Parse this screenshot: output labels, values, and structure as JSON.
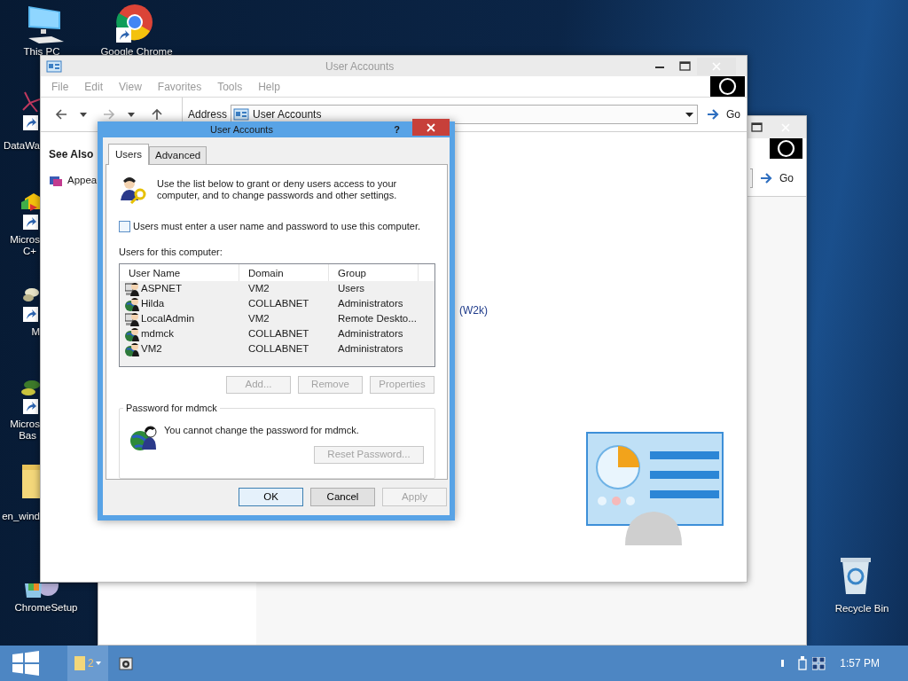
{
  "desktop_icons": [
    {
      "kind": "pc",
      "lines": [
        "This PC"
      ]
    },
    {
      "kind": "chrome",
      "lines": [
        "Google Chrome"
      ]
    },
    {
      "kind": "molecule",
      "lines": [
        "DataWa"
      ]
    },
    {
      "kind": "app",
      "lines": [
        "Micros",
        "C+"
      ]
    },
    {
      "kind": "tool",
      "lines": [
        "M"
      ]
    },
    {
      "kind": "leaf",
      "lines": [
        "Micros",
        "Bas"
      ]
    },
    {
      "kind": "folder",
      "lines": [
        "en_wind"
      ]
    },
    {
      "kind": "installer",
      "lines": [
        "ChromeSetup"
      ]
    },
    {
      "kind": "recycle",
      "lines": [
        "Recycle Bin"
      ]
    }
  ],
  "back_window": {
    "go_label": "Go"
  },
  "explorer": {
    "title": "User Accounts",
    "menu": [
      "File",
      "Edit",
      "View",
      "Favorites",
      "Tools",
      "Help"
    ],
    "nav_buttons": [
      {
        "kind": "back",
        "disabled": false
      },
      {
        "kind": "forward",
        "disabled": true
      },
      {
        "kind": "up",
        "disabled": false
      }
    ],
    "address_label": "Address",
    "address": "User Accounts",
    "go_label": "Go",
    "see_also": "See Also",
    "tasks": [
      "Appea"
    ],
    "content_text": "(W2k)"
  },
  "dialog": {
    "title": "User Accounts",
    "help": "?",
    "tabs": [
      {
        "label": "Users",
        "selected": true
      },
      {
        "label": "Advanced",
        "selected": false
      }
    ],
    "intro": "Use the list below to grant or deny users access to your computer, and to change passwords and other settings.",
    "require_password": {
      "label": "Users must enter a user name and password to use this computer.",
      "checked": false
    },
    "users_label": "Users for this computer:",
    "columns": [
      "User Name",
      "Domain",
      "Group"
    ],
    "users": [
      {
        "kind": "local",
        "name": "ASPNET",
        "domain": "VM2",
        "group": "Users"
      },
      {
        "kind": "domain",
        "name": "Hilda",
        "domain": "COLLABNET",
        "group": "Administrators"
      },
      {
        "kind": "local",
        "name": "LocalAdmin",
        "domain": "VM2",
        "group": "Remote Deskto..."
      },
      {
        "kind": "domain",
        "name": "mdmck",
        "domain": "COLLABNET",
        "group": "Administrators"
      },
      {
        "kind": "domain",
        "name": "VM2",
        "domain": "COLLABNET",
        "group": "Administrators"
      }
    ],
    "list_buttons": [
      {
        "label": "Add...",
        "disabled": true
      },
      {
        "label": "Remove",
        "disabled": true
      },
      {
        "label": "Properties",
        "disabled": true
      }
    ],
    "password_group": {
      "title": "Password for mdmck",
      "text": "You cannot change the password for mdmck.",
      "button": {
        "label": "Reset Password...",
        "disabled": true
      }
    },
    "buttons": [
      {
        "label": "OK",
        "disabled": false,
        "default": true
      },
      {
        "label": "Cancel",
        "disabled": false,
        "default": false
      },
      {
        "label": "Apply",
        "disabled": true,
        "default": false
      }
    ]
  },
  "taskbar": {
    "items": [
      {
        "kind": "folder",
        "count": "2",
        "active": true
      },
      {
        "kind": "app",
        "active": false
      }
    ],
    "clock": "1:57 PM"
  }
}
